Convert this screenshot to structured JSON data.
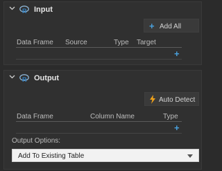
{
  "input": {
    "title": "Input",
    "add_all_label": "Add All",
    "columns": [
      "Data Frame",
      "Source",
      "Type",
      "Target"
    ]
  },
  "output": {
    "title": "Output",
    "auto_detect_label": "Auto Detect",
    "columns": [
      "Data Frame",
      "Column Name",
      "Type"
    ],
    "options_label": "Output Options:",
    "options_selected": "Add To Existing Table"
  },
  "colors": {
    "background": "#2b2b2b",
    "panel": "#303030",
    "accent_blue": "#4aa3e0",
    "lightning": "#f0a21a"
  },
  "icons": [
    "chevron-down-icon",
    "r-logo-icon",
    "plus-icon",
    "lightning-icon",
    "dropdown-arrow-icon"
  ]
}
